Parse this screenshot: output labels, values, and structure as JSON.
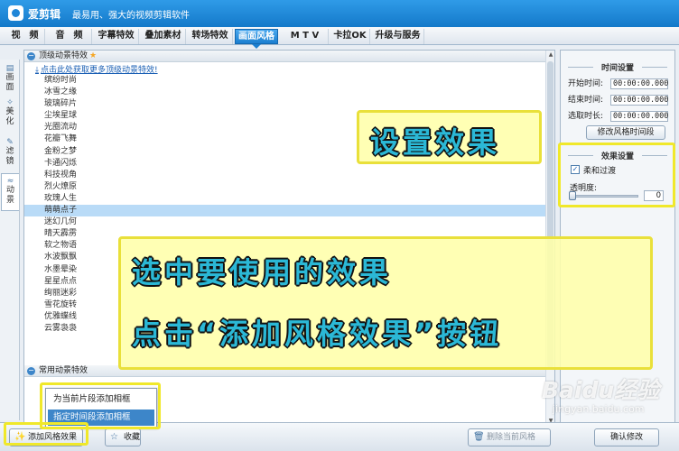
{
  "app": {
    "name": "爱剪辑",
    "slogan": "最易用、强大的视频剪辑软件"
  },
  "tabs": [
    {
      "label": "视　频"
    },
    {
      "label": "音　频"
    },
    {
      "label": "字幕特效"
    },
    {
      "label": "叠加素材"
    },
    {
      "label": "转场特效"
    },
    {
      "label": "画面风格",
      "active": true
    },
    {
      "label": "M T V"
    },
    {
      "label": "卡拉OK"
    },
    {
      "label": "升级与服务"
    }
  ],
  "left_nav": [
    {
      "label": "画面",
      "icon": "image-icon"
    },
    {
      "label": "美化",
      "icon": "magic-wand-icon"
    },
    {
      "label": "滤镜",
      "icon": "pen-icon"
    },
    {
      "label": "动景",
      "icon": "wave-icon",
      "active": true
    }
  ],
  "effect_panel": {
    "group1_title": "顶级动景特效",
    "download_link": "点击此处获取更多顶级动景特效!",
    "effects": [
      "缤纷时尚",
      "冰雪之缘",
      "玻璃碎片",
      "尘埃星球",
      "光圈流动",
      "花瓣飞舞",
      "金粉之梦",
      "卡通闪烁",
      "科技视角",
      "烈火燎原",
      "玫瑰人生",
      "萌萌点子",
      "迷幻几何",
      "晴天霹雳",
      "软之物语",
      "水波飘飘",
      "水墨晕染",
      "星星点点",
      "绚丽迷彩",
      "雪花旋转",
      "优雅蝶线",
      "云雾袅袅"
    ],
    "selected_index": 11,
    "group2_title": "常用动景特效"
  },
  "time_settings": {
    "title": "时间设置",
    "start_label": "开始时间:",
    "start_value": "00:00:00.000",
    "end_label": "结束时间:",
    "end_value": "00:00:00.000",
    "duration_label": "选取时长:",
    "duration_value": "00:00:00.000",
    "modify_button": "修改风格时间段"
  },
  "effect_settings": {
    "title": "效果设置",
    "soft_transition_label": "柔和过渡",
    "soft_transition_checked": true,
    "opacity_label": "透明度:",
    "opacity_value": "0"
  },
  "bottom": {
    "add_style_button": "添加风格效果",
    "favorite_button": "收藏",
    "delete_button": "删除当前风格",
    "confirm_button": "确认修改"
  },
  "popup_menu": {
    "item1": "为当前片段添加相框",
    "item2": "指定时间段添加相框"
  },
  "annotations": {
    "callout_settings": "设置效果",
    "callout_line1": "选中要使用的效果",
    "callout_line2": "点击“添加风格效果”按钮"
  },
  "watermark": {
    "logo": "Baidu经验",
    "url": "jingyan.baidu.com"
  },
  "colors": {
    "titlebar": "#1f86d8",
    "highlight": "#f0e82a",
    "callout_text": "#2bb8d6",
    "selected_row": "#b9dbf7"
  }
}
